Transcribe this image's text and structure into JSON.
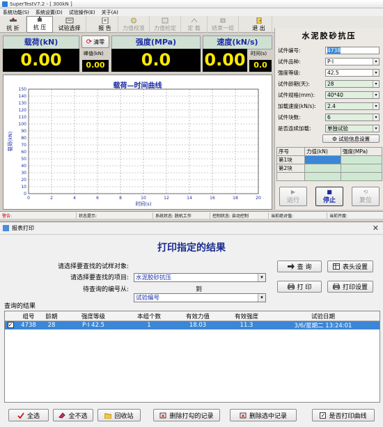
{
  "app": {
    "title": "SuperTestV7.2 - [ 300kN ]",
    "menu": [
      "系统功能(S)",
      "系统设置(D)",
      "试验操作(E)",
      "关于(A)"
    ],
    "toolbar": [
      {
        "label": "抗 折",
        "icon": "flex-icon",
        "state": "normal"
      },
      {
        "label": "抗 压",
        "icon": "compress-icon",
        "state": "selected"
      },
      {
        "label": "试验选择",
        "icon": "test-select-icon",
        "state": "normal"
      },
      {
        "label": "报 告",
        "icon": "report-icon",
        "state": "normal"
      },
      {
        "label": "力值校准",
        "icon": "calibrate-icon",
        "state": "disabled"
      },
      {
        "label": "力值检定",
        "icon": "verify-icon",
        "state": "disabled"
      },
      {
        "label": "定 载",
        "icon": "fixed-load-icon",
        "state": "disabled"
      },
      {
        "label": "结束一组",
        "icon": "end-group-icon",
        "state": "disabled"
      },
      {
        "label": "退 出",
        "icon": "exit-icon",
        "state": "normal"
      }
    ]
  },
  "meters": {
    "load": {
      "label": "载荷(kN)",
      "value": "0.00",
      "clear": "清零",
      "peak_label": "峰值(kN)",
      "peak": "0.00"
    },
    "strength": {
      "label": "强度(MPa)",
      "value": "0.0"
    },
    "speed": {
      "label": "速度(kN/s)",
      "value": "0.00",
      "time_label": "时间(s)",
      "time": "0.0"
    }
  },
  "chart_data": {
    "type": "line",
    "title": "载荷—时间曲线",
    "xlabel": "时间(s)",
    "ylabel": "载荷(kN)",
    "xlim": [
      0,
      20
    ],
    "ylim": [
      0,
      150
    ],
    "xticks": [
      0,
      2,
      4,
      6,
      8,
      10,
      12,
      14,
      16,
      18,
      20
    ],
    "yticks": [
      0,
      10,
      20,
      30,
      40,
      50,
      60,
      70,
      80,
      90,
      100,
      110,
      120,
      130,
      140,
      150
    ],
    "grid": true,
    "series": []
  },
  "params": {
    "title": "水泥胶砂抗压",
    "fields": [
      {
        "label": "试件编号:",
        "value": "4738",
        "highlight": false,
        "dropdown": false,
        "selected": true
      },
      {
        "label": "试件品种:",
        "value": "P·I",
        "highlight": false,
        "dropdown": true
      },
      {
        "label": "强度等级:",
        "value": "42.5",
        "highlight": false,
        "dropdown": true
      },
      {
        "label": "试件龄期(天):",
        "value": "28",
        "highlight": true,
        "dropdown": true
      },
      {
        "label": "试件规格(mm):",
        "value": "40*40",
        "highlight": true,
        "dropdown": true
      },
      {
        "label": "加载速度(kN/s):",
        "value": "2.4",
        "highlight": true,
        "dropdown": true
      },
      {
        "label": "试件块数:",
        "value": "6",
        "highlight": true,
        "dropdown": true
      },
      {
        "label": "是否连续加载:",
        "value": "单独试验",
        "highlight": true,
        "dropdown": true
      }
    ],
    "info_button": "试验信息设置",
    "table_headers": [
      "序号",
      "力值(kN)",
      "强度(MPa)"
    ],
    "table_rows": [
      "第1块",
      "第2块"
    ],
    "run": "运行",
    "stop": "停止",
    "reset": "复位"
  },
  "status": [
    "警告:",
    "状态提示:",
    "系统状态: 脱机工作",
    "控制状态: 自动控制",
    "当前绝对值:",
    "当前开度:"
  ],
  "report": {
    "window_title": "报表打印",
    "heading": "打印指定的结果",
    "object_label": "请选择要查找的试样对象:",
    "object_value": "水泥胶砂抗压",
    "item_label": "请选择要查找的项目:",
    "item_value": "试验编号",
    "range_label": "待查询的编号从:",
    "range_to": "到",
    "query": "查 询",
    "header_settings": "表头设置",
    "print": "打 印",
    "print_settings": "打印设置",
    "results_label": "查询的结果",
    "columns": [
      "组号",
      "龄期",
      "强度等级",
      "本组个数",
      "有效力值",
      "有效强度",
      "试验日期"
    ],
    "rows": [
      {
        "checked": true,
        "group": "4738",
        "age": "28",
        "grade": "P·I  42.5",
        "count": "1",
        "force": "18.03",
        "strength": "11.3",
        "date": "3/6/星期二 13:24:01"
      }
    ],
    "select_all": "全选",
    "select_none": "全不选",
    "recycle": "回收站",
    "delete_checked": "删除打勾的记录",
    "delete_selected": "删除选中记录",
    "print_curve": "是否打印曲线"
  }
}
